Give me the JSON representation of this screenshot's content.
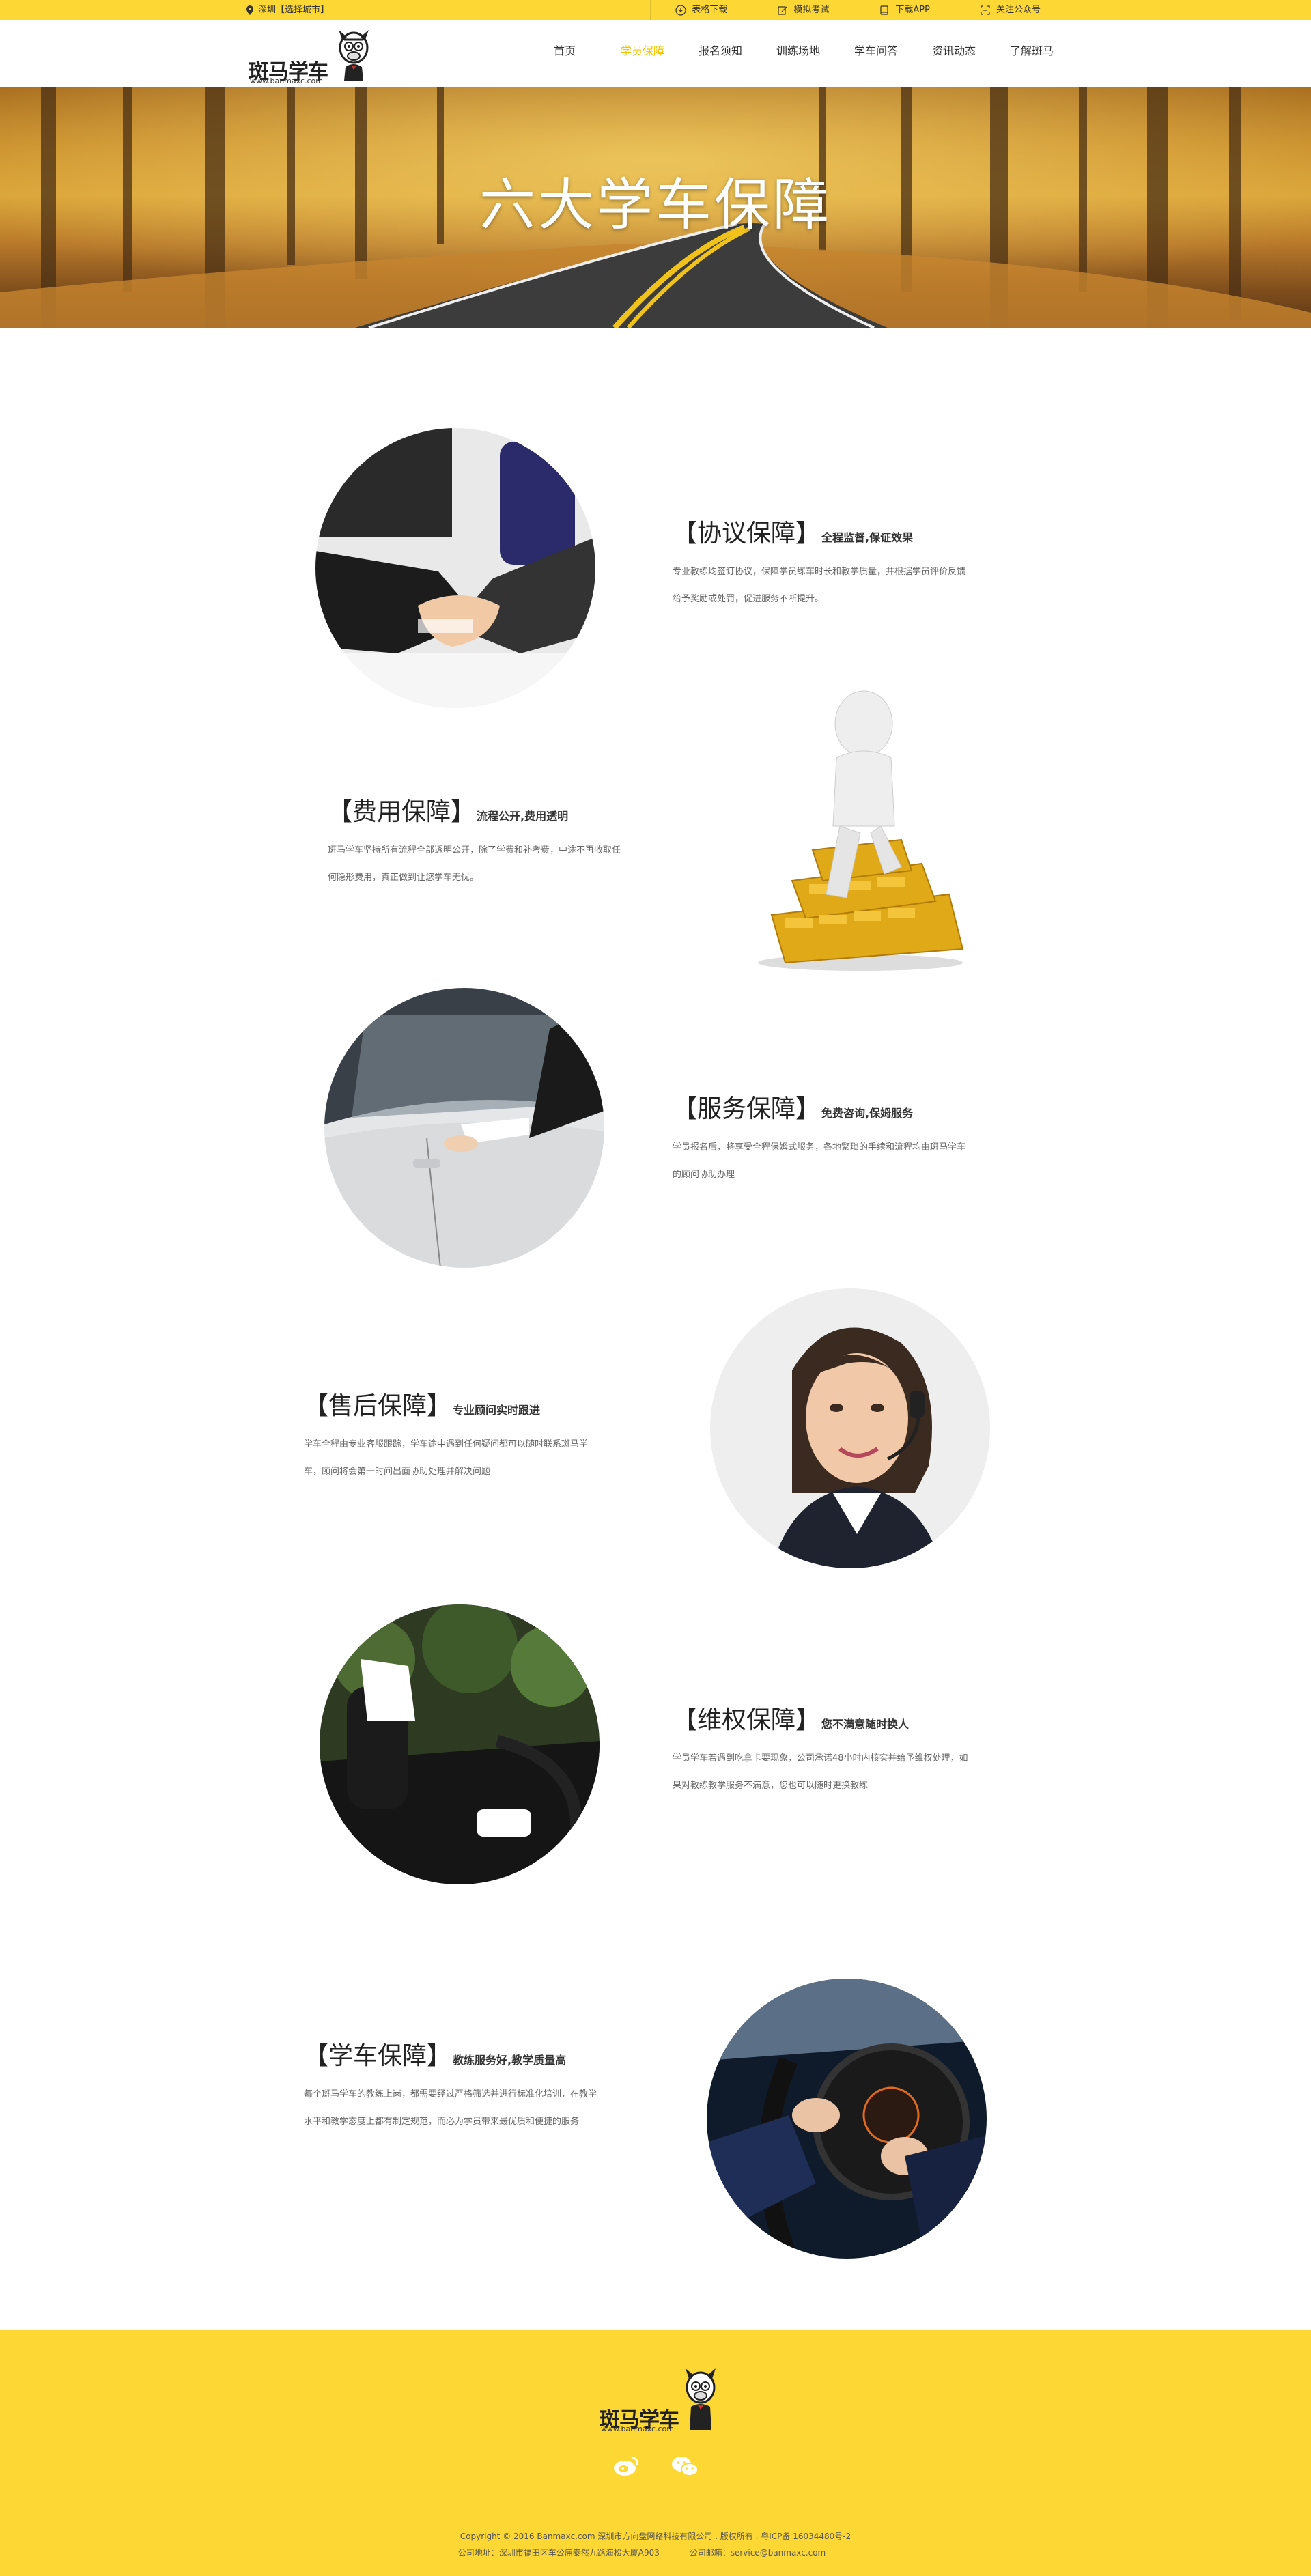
{
  "topbar": {
    "city": "深圳【选择城市】",
    "links": [
      {
        "label": "表格下载",
        "icon": "download-icon"
      },
      {
        "label": "模拟考试",
        "icon": "edit-icon"
      },
      {
        "label": "下载APP",
        "icon": "phone-icon"
      },
      {
        "label": "关注公众号",
        "icon": "qrcode-icon"
      }
    ]
  },
  "header": {
    "logo_text": "斑马学车",
    "logo_url": "www.banmaxc.com",
    "nav": [
      "首页",
      "学员保障",
      "报名须知",
      "训练场地",
      "学车问答",
      "资讯动态",
      "了解斑马"
    ],
    "active_index": 1
  },
  "banner": {
    "title": "六大学车保障"
  },
  "sections": [
    {
      "title": "【协议保障】",
      "subtitle": "全程监督,保证效果",
      "desc": "专业教练均签订协议，保障学员练车时长和教学质量，并根据学员评价反馈给予奖励或处罚，促进服务不断提升。"
    },
    {
      "title": "【费用保障】",
      "subtitle": "流程公开,费用透明",
      "desc": "斑马学车坚持所有流程全部透明公开，除了学费和补考费，中途不再收取任何隐形费用，真正做到让您学车无忧。"
    },
    {
      "title": "【服务保障】",
      "subtitle": "免费咨询,保姆服务",
      "desc": "学员报名后，将享受全程保姆式服务，各地繁琐的手续和流程均由斑马学车的顾问协助办理"
    },
    {
      "title": "【售后保障】",
      "subtitle": "专业顾问实时跟进",
      "desc": "学车全程由专业客服跟踪，学车途中遇到任何疑问都可以随时联系斑马学车，顾问将会第一时间出面协助处理并解决问题"
    },
    {
      "title": "【维权保障】",
      "subtitle": "您不满意随时换人",
      "desc": "学员学车若遇到吃拿卡要现象，公司承诺48小时内核实并给予维权处理，如果对教练教学服务不满意，您也可以随时更换教练"
    },
    {
      "title": "【学车保障】",
      "subtitle": "教练服务好,教学质量高",
      "desc": "每个斑马学车的教练上岗，都需要经过严格筛选并进行标准化培训，在教学水平和教学态度上都有制定规范，而必为学员带来最优质和便捷的服务"
    }
  ],
  "footer": {
    "logo_text": "斑马学车",
    "logo_url": "www.banmaxc.com",
    "social": [
      "weibo-icon",
      "wechat-icon"
    ],
    "copyright": "Copyright © 2016 Banmaxc.com   深圳市方向盘网络科技有限公司 . 版权所有 . 粤ICP备 16034480号-2",
    "address": "公司地址：深圳市福田区车公庙泰然九路海松大厦A903",
    "email": "公司邮箱：service@banmaxc.com"
  },
  "colors": {
    "accent": "#fdd835",
    "active_nav": "#f5c500"
  }
}
